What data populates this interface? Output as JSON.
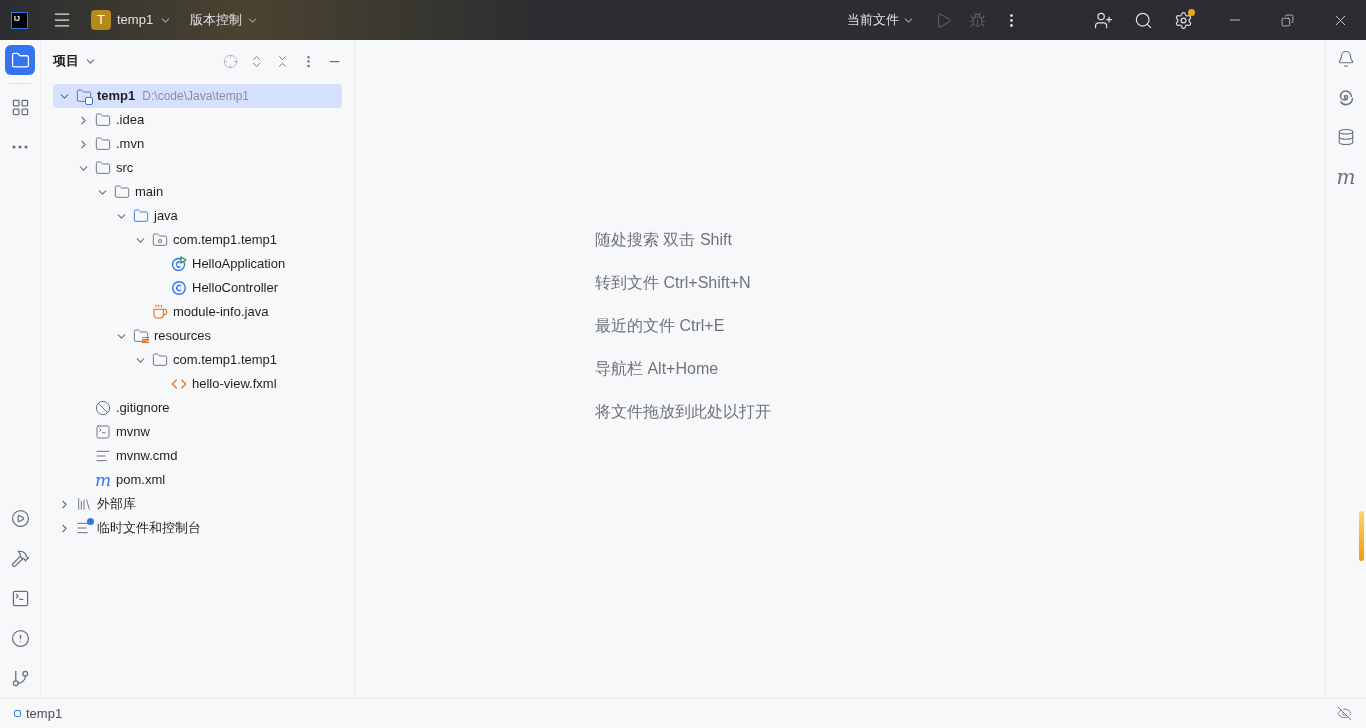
{
  "title_bar": {
    "logo_text": "IJ",
    "project": {
      "initial": "T",
      "name": "temp1"
    },
    "vcs": "版本控制",
    "run_config": "当前文件",
    "settings_badge": true
  },
  "left_toolbar": {
    "top": [
      {
        "kind": "project",
        "selected": true
      },
      {
        "kind": "structure",
        "selected": false
      },
      {
        "kind": "more",
        "selected": false
      }
    ],
    "bottom": [
      {
        "kind": "run",
        "selected": false
      },
      {
        "kind": "build",
        "selected": false
      },
      {
        "kind": "terminal",
        "selected": false
      },
      {
        "kind": "problems",
        "selected": false
      },
      {
        "kind": "git",
        "selected": false
      }
    ]
  },
  "project_panel": {
    "title": "项目",
    "tree": [
      {
        "name": "temp1",
        "path": "D:\\code\\Java\\temp1",
        "kind": "module",
        "expanded": true,
        "selected": true,
        "children": [
          {
            "name": ".idea",
            "kind": "folder",
            "expanded": false,
            "selected": false
          },
          {
            "name": ".mvn",
            "kind": "folder",
            "expanded": false,
            "selected": false
          },
          {
            "name": "src",
            "kind": "folder",
            "expanded": true,
            "selected": false,
            "children": [
              {
                "name": "main",
                "kind": "folder",
                "expanded": true,
                "selected": false,
                "children": [
                  {
                    "name": "java",
                    "kind": "source",
                    "expanded": true,
                    "selected": false,
                    "children": [
                      {
                        "name": "com.temp1.temp1",
                        "kind": "package",
                        "expanded": true,
                        "selected": false,
                        "children": [
                          {
                            "name": "HelloApplication",
                            "kind": "app_class",
                            "selected": false
                          },
                          {
                            "name": "HelloController",
                            "kind": "class",
                            "selected": false
                          }
                        ]
                      },
                      {
                        "name": "module-info.java",
                        "kind": "java",
                        "selected": false
                      }
                    ]
                  },
                  {
                    "name": "resources",
                    "kind": "resources",
                    "expanded": true,
                    "selected": false,
                    "children": [
                      {
                        "name": "com.temp1.temp1",
                        "kind": "folder",
                        "expanded": true,
                        "selected": false,
                        "children": [
                          {
                            "name": "hello-view.fxml",
                            "kind": "xml",
                            "selected": false
                          }
                        ]
                      }
                    ]
                  }
                ]
              }
            ]
          },
          {
            "name": ".gitignore",
            "kind": "ignore",
            "selected": false
          },
          {
            "name": "mvnw",
            "kind": "shell",
            "selected": false
          },
          {
            "name": "mvnw.cmd",
            "kind": "text",
            "selected": false
          },
          {
            "name": "pom.xml",
            "kind": "maven",
            "glyph": "m",
            "selected": false
          }
        ]
      },
      {
        "name": "外部库",
        "kind": "library",
        "expanded": false,
        "selected": false
      },
      {
        "name": "临时文件和控制台",
        "kind": "scratch",
        "expanded": false,
        "selected": false
      }
    ]
  },
  "editor_hints": [
    "随处搜索 双击 Shift",
    "转到文件 Ctrl+Shift+N",
    "最近的文件 Ctrl+E",
    "导航栏 Alt+Home",
    "将文件拖放到此处以打开"
  ],
  "right_toolbar": [
    {
      "kind": "notifications"
    },
    {
      "kind": "ai"
    },
    {
      "kind": "database"
    },
    {
      "kind": "maven",
      "glyph": "m"
    }
  ],
  "status_bar": {
    "path": "temp1"
  }
}
